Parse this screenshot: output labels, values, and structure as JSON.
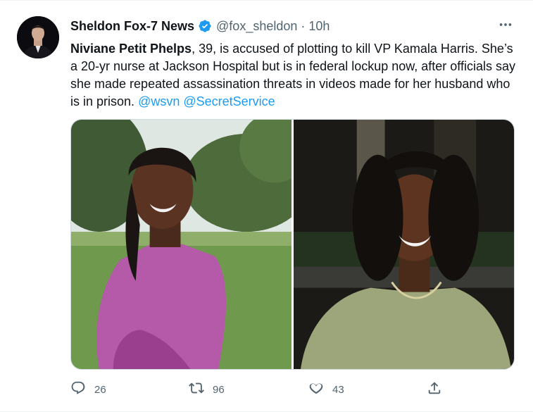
{
  "author": {
    "display_name": "Sheldon Fox-7 News",
    "handle": "@fox_sheldon",
    "separator": "·",
    "time": "10h",
    "verified": true
  },
  "tweet": {
    "name_bold": "Niviane Petit Phelps",
    "body": ", 39, is accused of plotting to kill VP Kamala Harris. She’s a 20-yr nurse at Jackson Hospital but is in federal lockup now, after officials say she made repeated assassination threats in videos made for her husband who is in prison.",
    "mentions": [
      "@wsvn",
      "@SecretService"
    ]
  },
  "media": {
    "photo_count": 2
  },
  "actions": {
    "reply_count": "26",
    "retweet_count": "96",
    "like_count": "43"
  },
  "icons": {
    "verified": "verified-badge-icon",
    "more": "more-options-icon",
    "reply": "reply-icon",
    "retweet": "retweet-icon",
    "like": "heart-icon",
    "share": "share-icon"
  },
  "colors": {
    "accent": "#1d9bf0",
    "text_primary": "#0f1419",
    "text_secondary": "#536471"
  }
}
